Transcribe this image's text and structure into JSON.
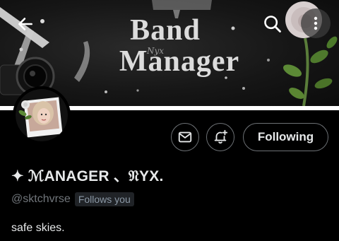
{
  "banner": {
    "title_line1": "Band",
    "title_line2": "Manager",
    "script_text": "Nyx"
  },
  "nav": {
    "back_icon": "arrow-left-icon",
    "search_icon": "search-icon",
    "more_icon": "more-vertical-icon"
  },
  "profile": {
    "display_name": "✦ ℳANAGER 、𝔑YX.",
    "handle": "@sktchvrse",
    "follows_you": "Follows you",
    "bio": "safe skies."
  },
  "actions": {
    "message_icon": "envelope-icon",
    "notify_icon": "bell-plus-icon",
    "following_label": "Following"
  },
  "colors": {
    "background": "#000000",
    "text_primary": "#e7e9ea",
    "text_secondary": "#71767b",
    "border": "#6d7175"
  }
}
